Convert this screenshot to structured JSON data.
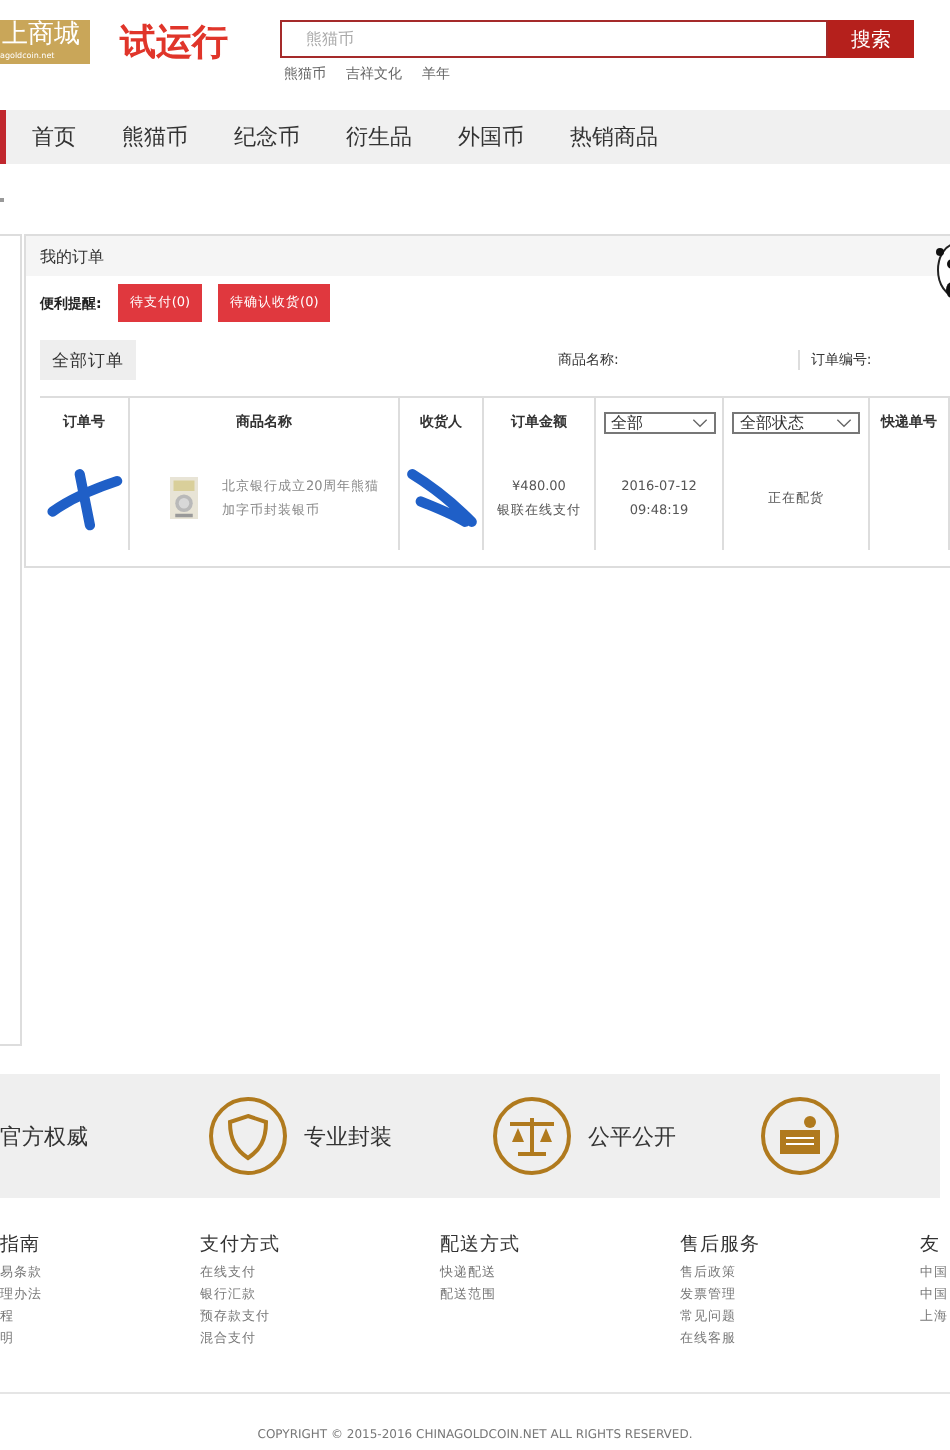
{
  "header": {
    "logo": {
      "title": "上商城",
      "domain": "agoldcoin.net"
    },
    "badge": "试运行",
    "search": {
      "placeholder": "熊猫币",
      "button": "搜索"
    },
    "hot_words": [
      "熊猫币",
      "吉祥文化",
      "羊年"
    ]
  },
  "nav": [
    {
      "label": "首页",
      "selected": false
    },
    {
      "label": "熊猫币",
      "selected": false
    },
    {
      "label": "纪念币",
      "selected": false
    },
    {
      "label": "衍生品",
      "selected": false
    },
    {
      "label": "外国币",
      "selected": false
    },
    {
      "label": "热销商品",
      "selected": false
    }
  ],
  "orders": {
    "title": "我的订单",
    "reminder_label": "便利提醒:",
    "reminders": [
      "待支付(0)",
      "待确认收货(0)"
    ],
    "tabs": [
      {
        "label": "全部订单",
        "selected": true
      }
    ],
    "filters": [
      {
        "label": "商品名称:"
      },
      {
        "label": "订单编号:"
      }
    ],
    "columns": [
      {
        "kind": "text",
        "label": "订单号"
      },
      {
        "kind": "text",
        "label": "商品名称"
      },
      {
        "kind": "text",
        "label": "收货人"
      },
      {
        "kind": "text",
        "label": "订单金额"
      },
      {
        "kind": "select",
        "label": "全部"
      },
      {
        "kind": "select",
        "label": "全部状态"
      },
      {
        "kind": "text",
        "label": "快递单号"
      }
    ],
    "rows": [
      {
        "product": "北京银行成立20周年熊猫加字币封装银币",
        "amount": "¥480.00",
        "payment": "银联在线支付",
        "date": "2016-07-12",
        "time": "09:48:19",
        "status": "正在配货",
        "redacted": true
      }
    ]
  },
  "features": [
    {
      "kind": "clipped",
      "label": "官方权威"
    },
    {
      "kind": "shield",
      "label": "专业封装"
    },
    {
      "kind": "scales",
      "label": "公平公开"
    },
    {
      "kind": "certificate"
    }
  ],
  "footer": {
    "columns": [
      {
        "title": "指南",
        "links": [
          "易条款",
          "理办法",
          "程",
          "明"
        ]
      },
      {
        "title": "支付方式",
        "links": [
          "在线支付",
          "银行汇款",
          "预存款支付",
          "混合支付"
        ]
      },
      {
        "title": "配送方式",
        "links": [
          "快递配送",
          "配送范围"
        ]
      },
      {
        "title": "售后服务",
        "links": [
          "售后政策",
          "发票管理",
          "常见问题",
          "在线客服"
        ]
      },
      {
        "title": "友",
        "links": [
          "中国",
          "中国",
          "上海"
        ]
      }
    ],
    "copyright": "COPYRIGHT © 2015-2016 CHINAGOLDCOIN.NET ALL RIGHTS RESERVED."
  }
}
